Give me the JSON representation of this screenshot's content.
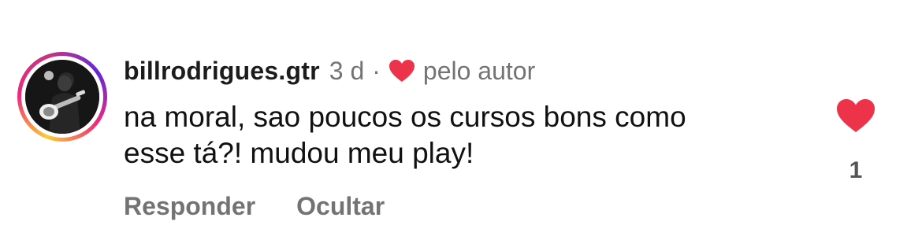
{
  "comment": {
    "username": "billrodrigues.gtr",
    "time": "3 d",
    "separator": "·",
    "liked_by_author_label": "pelo autor",
    "text_line1": "na moral, sao poucos os cursos bons como",
    "text_line2": "esse tá?! mudou meu play!",
    "like_count": "1"
  },
  "actions": {
    "reply_label": "Responder",
    "hide_label": "Ocultar"
  },
  "colors": {
    "heart": "#ed3349",
    "muted_text": "#737373",
    "story_ring": [
      "#f9ce34",
      "#ee2a7b",
      "#6228d7"
    ]
  },
  "icons": {
    "author_like": "heart-icon",
    "like_button": "heart-icon",
    "avatar_ring": "story-ring"
  }
}
